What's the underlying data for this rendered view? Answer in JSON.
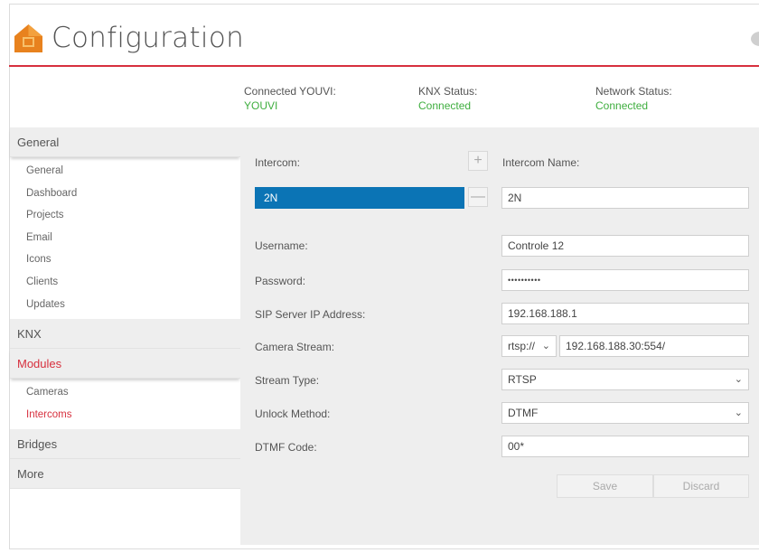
{
  "header": {
    "title": "Configuration"
  },
  "status": {
    "youvi": {
      "label": "Connected YOUVI:",
      "value": "YOUVI"
    },
    "knx": {
      "label": "KNX Status:",
      "value": "Connected"
    },
    "network": {
      "label": "Network Status:",
      "value": "Connected"
    }
  },
  "sidebar": {
    "general": {
      "label": "General",
      "items": [
        "General",
        "Dashboard",
        "Projects",
        "Email",
        "Icons",
        "Clients",
        "Updates"
      ]
    },
    "knx": {
      "label": "KNX"
    },
    "modules": {
      "label": "Modules",
      "items": [
        "Cameras",
        "Intercoms"
      ]
    },
    "bridges": {
      "label": "Bridges"
    },
    "more": {
      "label": "More"
    }
  },
  "main": {
    "intercom_label": "Intercom:",
    "add_symbol": "+",
    "remove_symbol": "—",
    "intercom_list": [
      "2N"
    ],
    "intercom_name_label": "Intercom Name:",
    "intercom_name_value": "2N",
    "username_label": "Username:",
    "username_value": "Controle 12",
    "password_label": "Password:",
    "password_value": "••••••••••",
    "sip_label": "SIP Server IP Address:",
    "sip_value": "192.168.188.1",
    "camera_label": "Camera Stream:",
    "camera_protocol": "rtsp://",
    "camera_address": "192.168.188.30:554/",
    "stream_type_label": "Stream Type:",
    "stream_type_value": "RTSP",
    "unlock_label": "Unlock Method:",
    "unlock_value": "DTMF",
    "dtmf_label": "DTMF Code:",
    "dtmf_value": "00*",
    "save_label": "Save",
    "discard_label": "Discard",
    "chevron": "⌄"
  },
  "colors": {
    "accent": "#d7303e",
    "selected": "#0b74b5",
    "connected": "#3fae3f",
    "logo": "#e8821e"
  },
  "icons": {
    "logo": "home-app-logo-icon",
    "chat": "chat-bubble-icon"
  }
}
